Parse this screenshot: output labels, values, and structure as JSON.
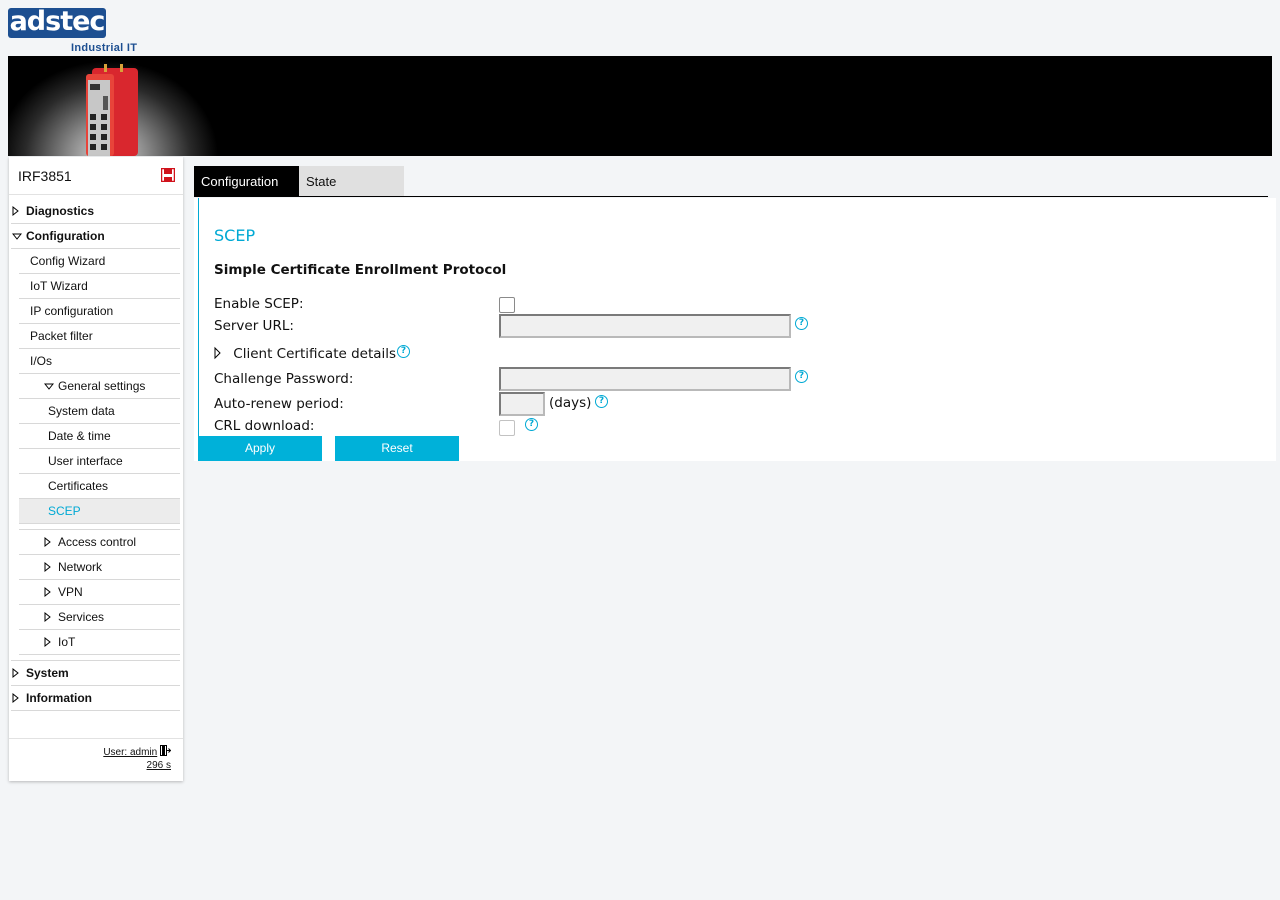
{
  "brand": {
    "logo_text": "adstec",
    "tagline": "Industrial IT"
  },
  "sidebar": {
    "device_name": "IRF3851",
    "items": [
      {
        "label": "Diagnostics"
      },
      {
        "label": "Configuration"
      },
      {
        "label": "Config Wizard"
      },
      {
        "label": "IoT Wizard"
      },
      {
        "label": "IP configuration"
      },
      {
        "label": "Packet filter"
      },
      {
        "label": "I/Os"
      },
      {
        "label": "General settings"
      },
      {
        "label": "System data"
      },
      {
        "label": "Date & time"
      },
      {
        "label": "User interface"
      },
      {
        "label": "Certificates"
      },
      {
        "label": "SCEP"
      },
      {
        "label": "Access control"
      },
      {
        "label": "Network"
      },
      {
        "label": "VPN"
      },
      {
        "label": "Services"
      },
      {
        "label": "IoT"
      },
      {
        "label": "System"
      },
      {
        "label": "Information"
      }
    ],
    "user_label": "User: admin",
    "session_timer": "296 s"
  },
  "tabs": [
    {
      "label": "Configuration"
    },
    {
      "label": "State"
    }
  ],
  "form": {
    "page_title": "SCEP",
    "section_title": "Simple Certificate Enrollment Protocol",
    "enable_label": "Enable SCEP:",
    "enable_checked": false,
    "server_url_label": "Server URL:",
    "server_url_value": "",
    "client_cert_label": "Client Certificate details",
    "challenge_label": "Challenge Password:",
    "challenge_value": "",
    "autorenew_label": "Auto-renew period:",
    "autorenew_value": "",
    "autorenew_unit": "(days)",
    "crl_label": "CRL download:",
    "crl_checked": false,
    "help_glyph": "?"
  },
  "buttons": {
    "apply": "Apply",
    "reset": "Reset"
  },
  "colors": {
    "accent": "#00a9d4",
    "button": "#00b1d9",
    "brand": "#1d4f91",
    "active_tab": "#000000"
  }
}
